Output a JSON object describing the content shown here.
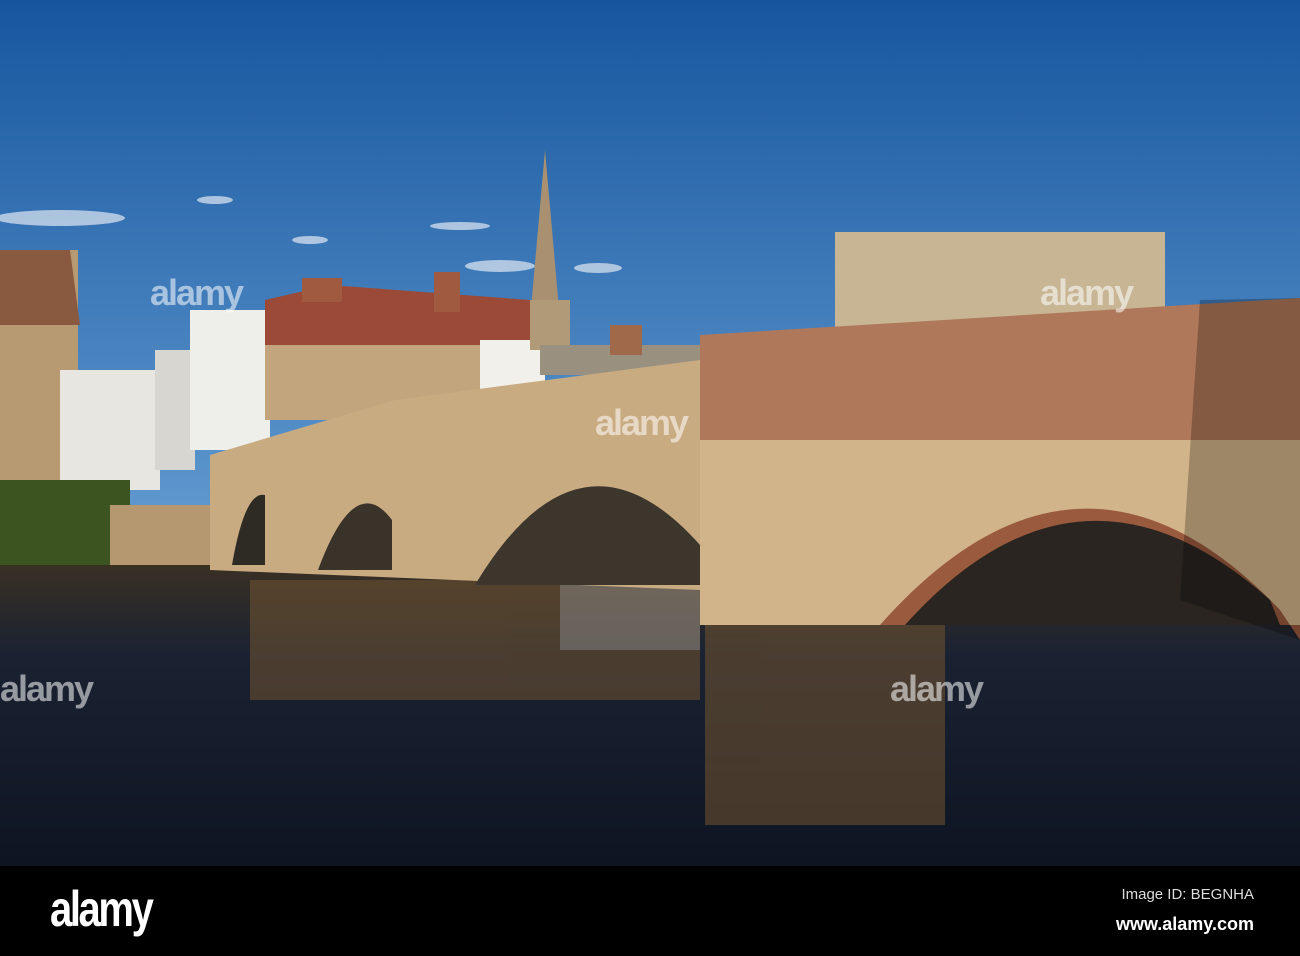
{
  "photo": {
    "watermark_text": "alamy",
    "colors": {
      "sky_top": "#17569f",
      "sky_bottom": "#6ba3d6",
      "water": "#141a26",
      "stone": "#c9ab82",
      "brick": "#b0785a"
    }
  },
  "footer": {
    "logo": "alamy",
    "image_id": "Image ID: BEGNHA",
    "website": "www.alamy.com"
  }
}
